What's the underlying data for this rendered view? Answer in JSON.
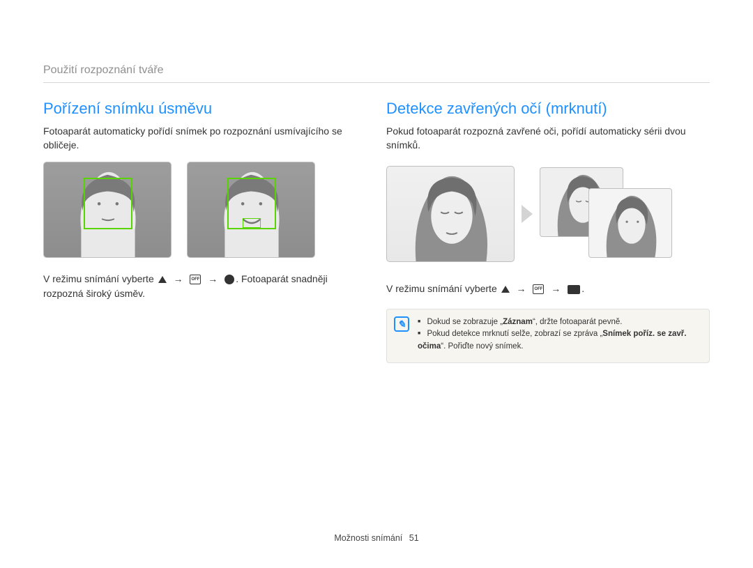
{
  "breadcrumb": "Použití rozpoznání tváře",
  "left": {
    "heading": "Pořízení snímku úsměvu",
    "lead": "Fotoaparát automaticky pořídí snímek po rozpoznání usmívajícího se obličeje.",
    "instr_prefix": "V režimu snímání vyberte ",
    "instr_suffix": ". Fotoaparát snadněji rozpozná široký úsměv."
  },
  "right": {
    "heading": "Detekce zavřených očí (mrknutí)",
    "lead": "Pokud fotoaparát rozpozná zavřené oči, pořídí automaticky sérii dvou snímků.",
    "instr_prefix": "V režimu snímání vyberte ",
    "instr_suffix": ".",
    "note1_a": "Dokud se zobrazuje „",
    "note1_b": "Záznam",
    "note1_c": "“, držte fotoaparát pevně.",
    "note2_a": "Pokud detekce mrknutí selže, zobrazí se zpráva „",
    "note2_b": "Snímek poříz. se zavř. očima",
    "note2_c": "“. Pořiďte nový snímek."
  },
  "footer": {
    "label": "Možnosti snímání",
    "page": "51"
  }
}
